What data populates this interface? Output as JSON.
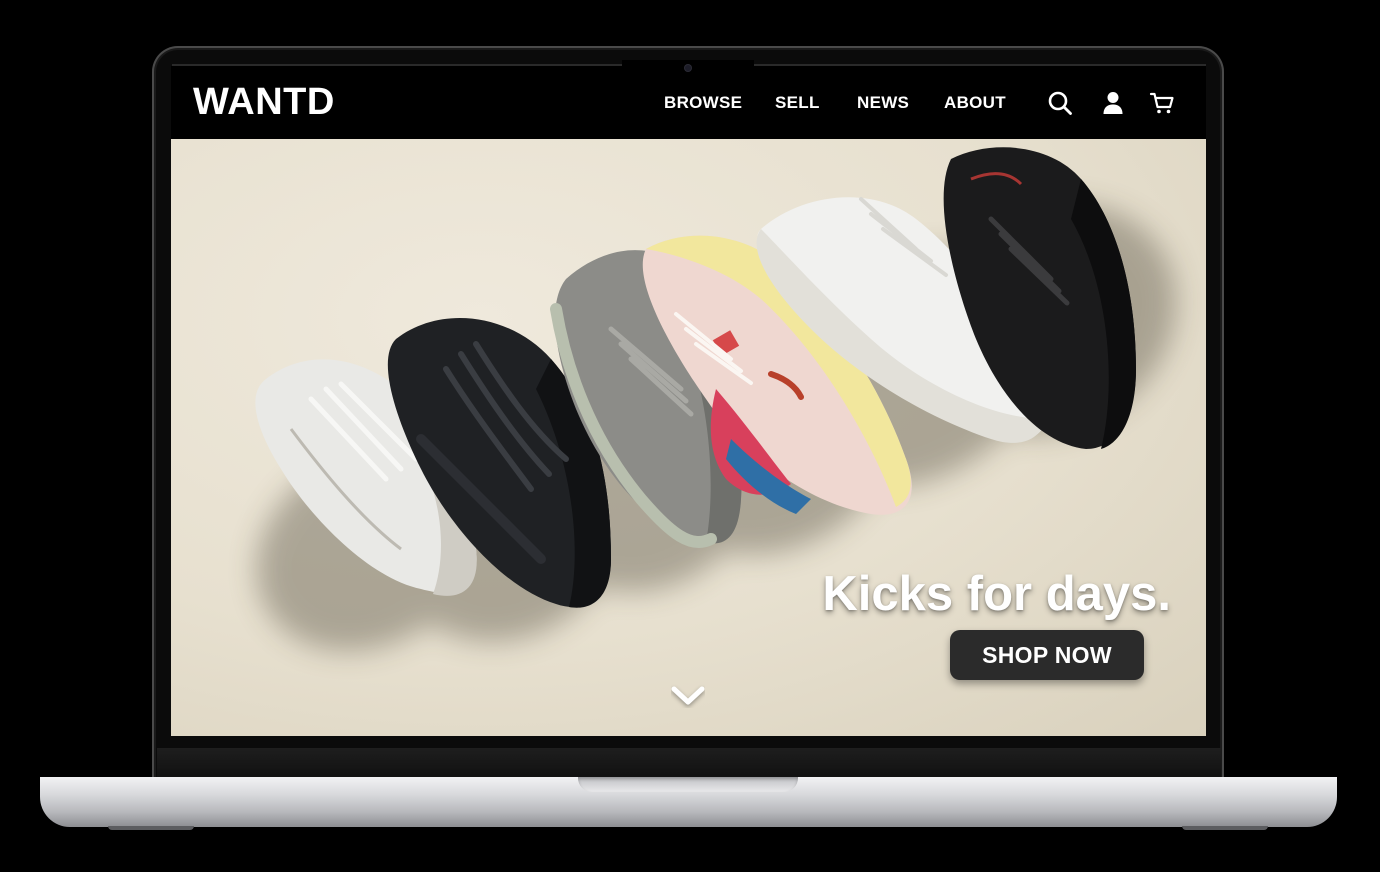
{
  "app": {
    "logo_text": "WANTD"
  },
  "nav": {
    "links": [
      {
        "label": "BROWSE"
      },
      {
        "label": "SELL"
      },
      {
        "label": "NEWS"
      },
      {
        "label": "ABOUT"
      }
    ],
    "icons": [
      "search-icon",
      "user-icon",
      "cart-icon"
    ]
  },
  "hero": {
    "headline": "Kicks for days.",
    "cta_label": "SHOP NOW",
    "scroll_icon": "chevron-down-icon"
  },
  "colors": {
    "navbar_bg": "#000000",
    "hero_bg": "#e8e2d2",
    "cta_bg": "#2b2b2b",
    "text_light": "#ffffff"
  }
}
